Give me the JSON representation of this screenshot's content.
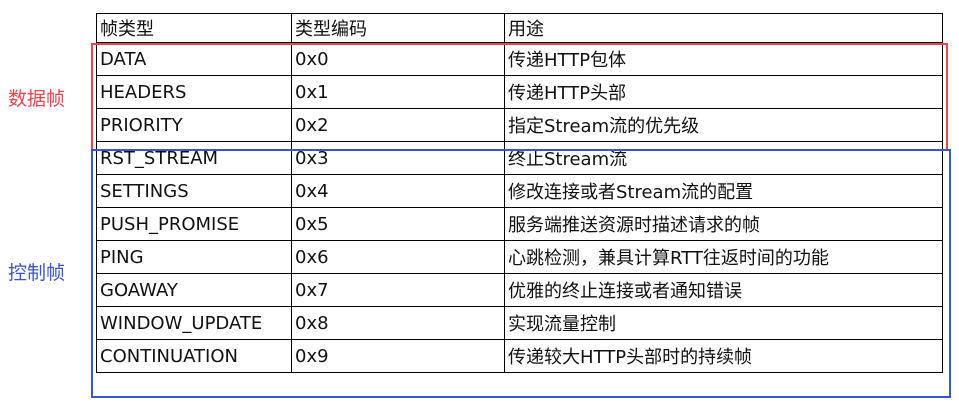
{
  "headers": [
    "帧类型",
    "类型编码",
    "用途"
  ],
  "rows": [
    [
      "DATA",
      "0x0",
      "传递HTTP包体"
    ],
    [
      "HEADERS",
      "0x1",
      "传递HTTP头部"
    ],
    [
      "PRIORITY",
      "0x2",
      "指定Stream流的优先级"
    ],
    [
      "RST_STREAM",
      "0x3",
      "终止Stream流"
    ],
    [
      "SETTINGS",
      "0x4",
      "修改连接或者Stream流的配置"
    ],
    [
      "PUSH_PROMISE",
      "0x5",
      "服务端推送资源时描述请求的帧"
    ],
    [
      "PING",
      "0x6",
      "心跳检测，兼具计算RTT往返时间的功能"
    ],
    [
      "GOAWAY",
      "0x7",
      "优雅的终止连接或者通知错误"
    ],
    [
      "WINDOW_UPDATE",
      "0x8",
      "实现流量控制"
    ],
    [
      "CONTINUATION",
      "0x9",
      "传递较大HTTP头部时的持续帧"
    ]
  ],
  "groups": {
    "data_frames": {
      "label": "数据帧",
      "color": "#e8474f"
    },
    "control_frames": {
      "label": "控制帧",
      "color": "#3a55c9"
    }
  }
}
